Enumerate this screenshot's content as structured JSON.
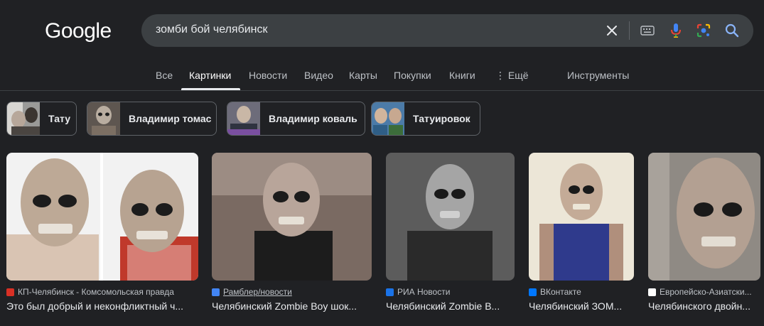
{
  "logo": {
    "text": "Google"
  },
  "search": {
    "query": "зомби бой челябинск"
  },
  "tabs": [
    {
      "label": "Все"
    },
    {
      "label": "Картинки"
    },
    {
      "label": "Новости"
    },
    {
      "label": "Видео"
    },
    {
      "label": "Карты"
    },
    {
      "label": "Покупки"
    },
    {
      "label": "Книги"
    },
    {
      "label": "⋮ Ещё"
    }
  ],
  "tools": {
    "label": "Инструменты"
  },
  "chips": [
    {
      "label": "Тату"
    },
    {
      "label": "Владимир томас"
    },
    {
      "label": "Владимир коваль"
    },
    {
      "label": "Татуировок"
    }
  ],
  "results": [
    {
      "source": "КП-Челябинск - Комсомольская правда",
      "title": "Это был добрый и неконфликтный ч...",
      "favicon_color": "#d93025"
    },
    {
      "source": "Рамблер/новости",
      "title": "Челябинский Zombie Boy шок...",
      "favicon_color": "#4285f4"
    },
    {
      "source": "РИА Новости",
      "title": "Челябинский Zombie B...",
      "favicon_color": "#1a73e8"
    },
    {
      "source": "ВКонтакте",
      "title": "Челябинский ЗОМ...",
      "favicon_color": "#0077ff"
    },
    {
      "source": "Европейско-Азиатски...",
      "title": "Челябинского двойн...",
      "favicon_color": "#ffffff"
    }
  ],
  "colors": {
    "background": "#202124",
    "search_bg": "#3c4043",
    "text": "#e8eaed",
    "muted": "#bdc1c6"
  }
}
